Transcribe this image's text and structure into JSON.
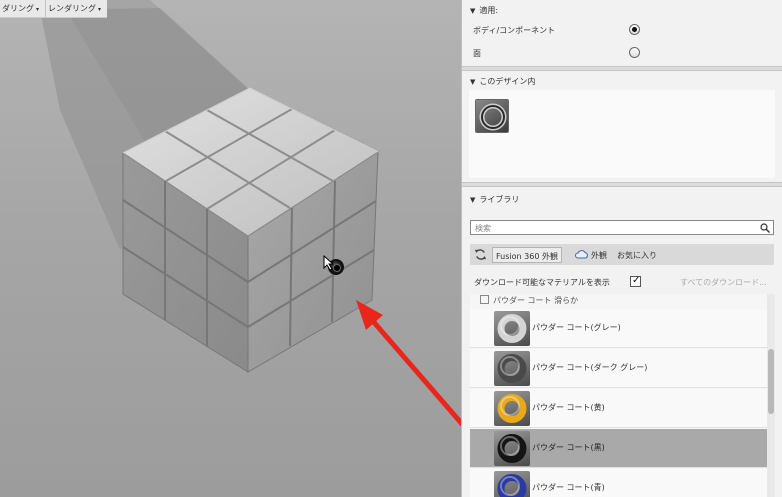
{
  "viewport": {
    "menu": [
      {
        "label": "ダリング"
      },
      {
        "label": "レンダリング"
      }
    ],
    "caret": "▾"
  },
  "panel": {
    "apply": {
      "title": "適用:",
      "options": [
        {
          "label": "ボディ/コンポーネント",
          "selected": true
        },
        {
          "label": "面",
          "selected": false
        }
      ]
    },
    "in_design": {
      "title": "このデザイン内",
      "thumbnail_color": "#4a4a4a"
    },
    "library": {
      "title": "ライブラリ",
      "search_placeholder": "検索",
      "tabs": [
        {
          "label": "Fusion 360 外観",
          "active": true
        },
        {
          "label": "外観",
          "active": false
        },
        {
          "label": "お気に入り",
          "active": false
        }
      ],
      "download_label": "ダウンロード可能なマテリアルを表示",
      "download_checked": true,
      "all_downloads": "すべてのダウンロード...",
      "group_header": "パウダー コート 滑らか",
      "items": [
        {
          "label": "パウダー コート(グレー)",
          "color": "#d4d4d4",
          "selected": false
        },
        {
          "label": "パウダー コート(ダーク グレー)",
          "color": "#4a4a4a",
          "selected": false
        },
        {
          "label": "パウダー コート(黄)",
          "color": "#e8a91c",
          "selected": false
        },
        {
          "label": "パウダー コート(黒)",
          "color": "#141414",
          "selected": true
        },
        {
          "label": "パウダー コート(青)",
          "color": "#2a3aa0",
          "selected": false
        }
      ]
    }
  },
  "colors": {
    "arrow": "#e8261b",
    "cube_face": "#cfcfcf"
  }
}
